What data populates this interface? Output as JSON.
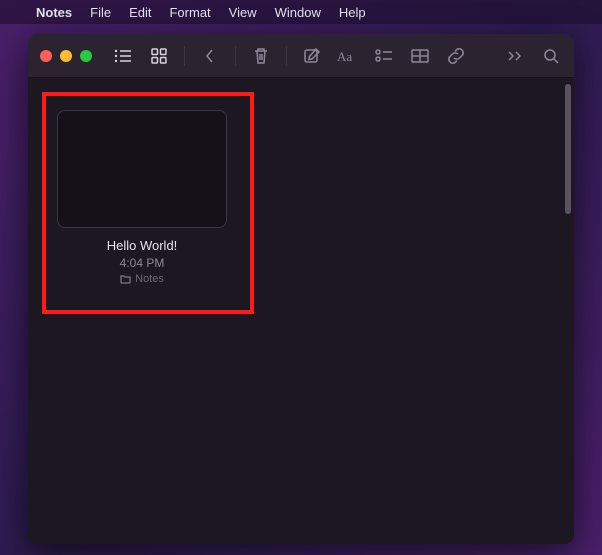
{
  "menubar": {
    "app_name": "Notes",
    "items": [
      "File",
      "Edit",
      "Format",
      "View",
      "Window",
      "Help"
    ]
  },
  "toolbar": {
    "icons": {
      "list_view": "list-view-icon",
      "grid_view": "grid-view-icon",
      "back": "back-icon",
      "delete": "trash-icon",
      "new_note": "compose-icon",
      "text_style": "text-style-icon",
      "checklist": "checklist-icon",
      "table": "table-icon",
      "link": "link-icon",
      "overflow": "overflow-icon",
      "search": "search-icon"
    }
  },
  "notes": [
    {
      "title": "Hello World!",
      "time": "4:04 PM",
      "folder": "Notes"
    }
  ]
}
